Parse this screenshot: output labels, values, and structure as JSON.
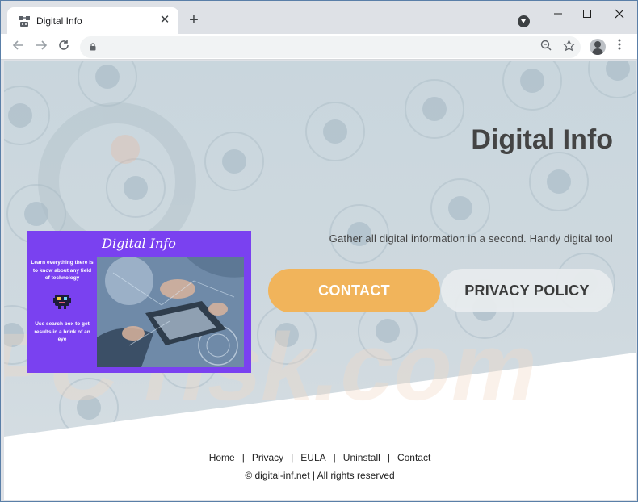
{
  "browser": {
    "tab_title": "Digital Info",
    "new_tab_symbol": "+",
    "close_symbol": "✕"
  },
  "hero": {
    "title": "Digital Info",
    "tagline": "Gather all digital information in a second. Handy digital tool",
    "contact_label": "CONTACT",
    "privacy_label": "PRIVACY POLICY"
  },
  "promo": {
    "title": "Digital Info",
    "text_top": "Learn everything there is to know about any field of technology",
    "text_bottom": "Use search box to get results in a brink of an eye"
  },
  "footer": {
    "links": [
      "Home",
      "Privacy",
      "EULA",
      "Uninstall",
      "Contact"
    ],
    "separator": "|",
    "copyright": "© digital-inf.net | All rights reserved"
  },
  "colors": {
    "contact_button": "#f1b45b",
    "promo_bg": "#7a41f0",
    "page_bg": "#c9d6dd"
  }
}
